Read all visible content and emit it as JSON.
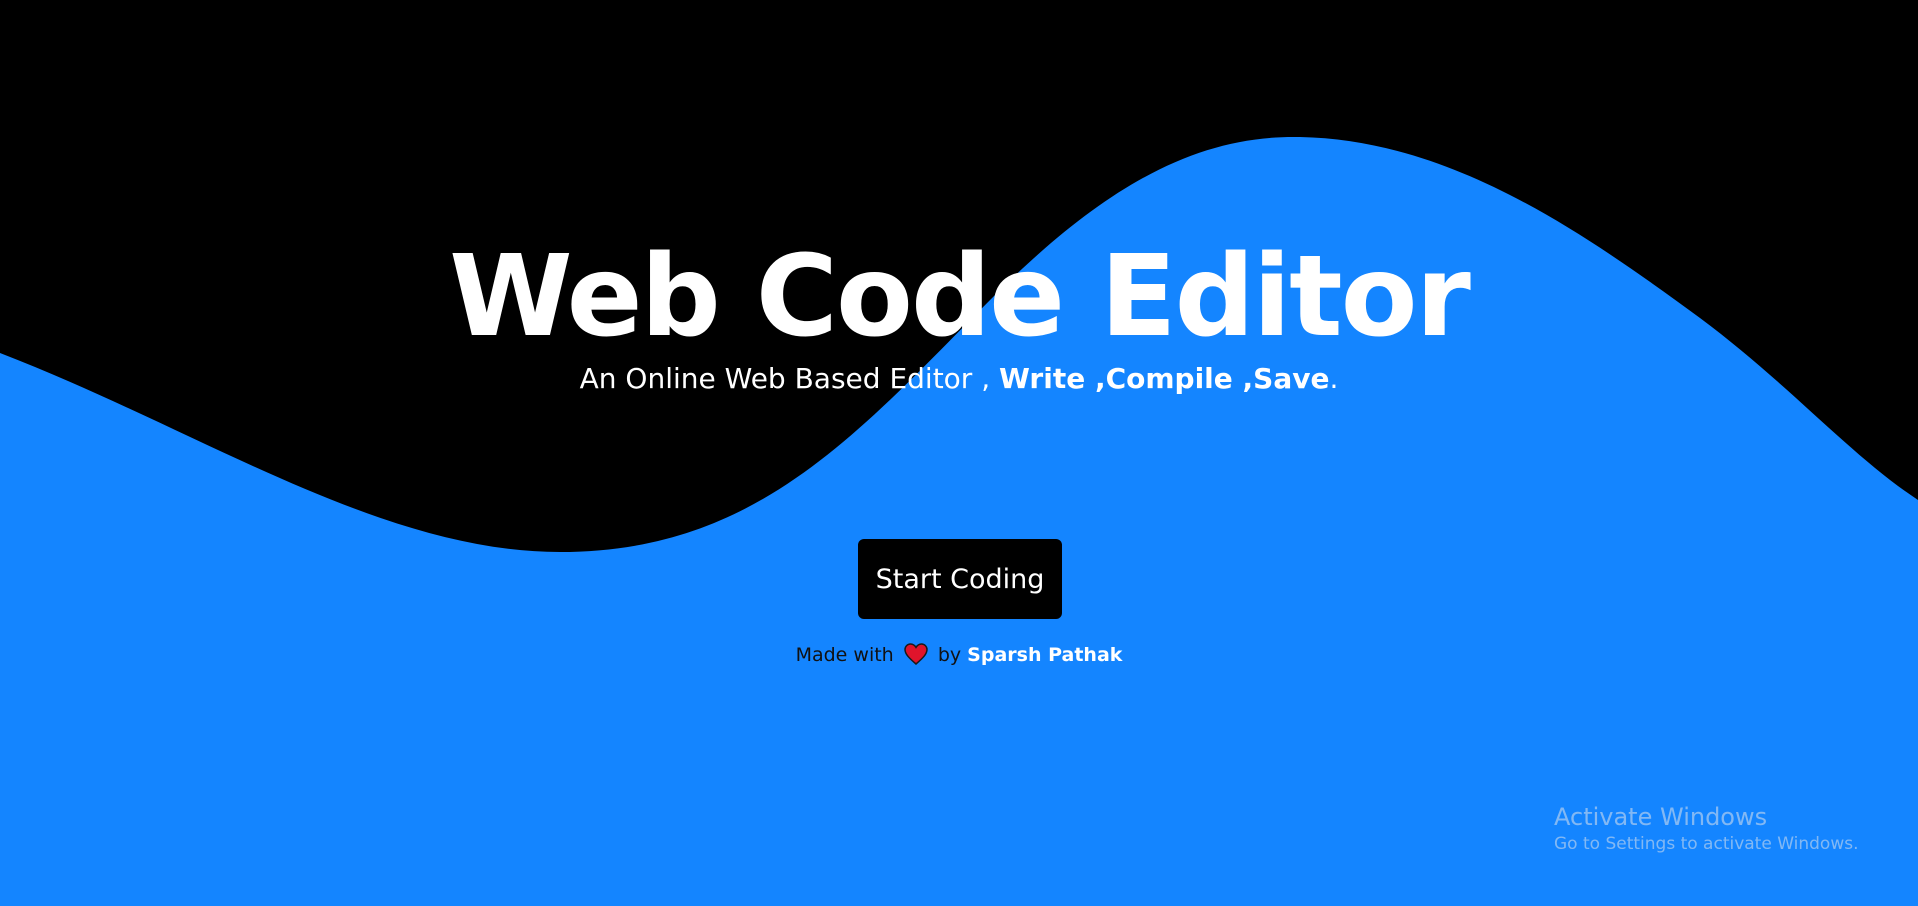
{
  "colors": {
    "background": "#000000",
    "wave": "#1485ff",
    "text": "#ffffff",
    "heart": "#e0142b"
  },
  "hero": {
    "title": "Web Code Editor",
    "subtitle_plain": "An Online Web Based Editor ,",
    "subtitle_bold": "Write ,Compile ,Save",
    "subtitle_end": "."
  },
  "cta": {
    "label": "Start Coding"
  },
  "credit": {
    "prefix": "Made with",
    "icon": "heart-icon",
    "by": "by",
    "author": "Sparsh Pathak"
  },
  "watermark": {
    "title": "Activate Windows",
    "subtitle": "Go to Settings to activate Windows."
  }
}
